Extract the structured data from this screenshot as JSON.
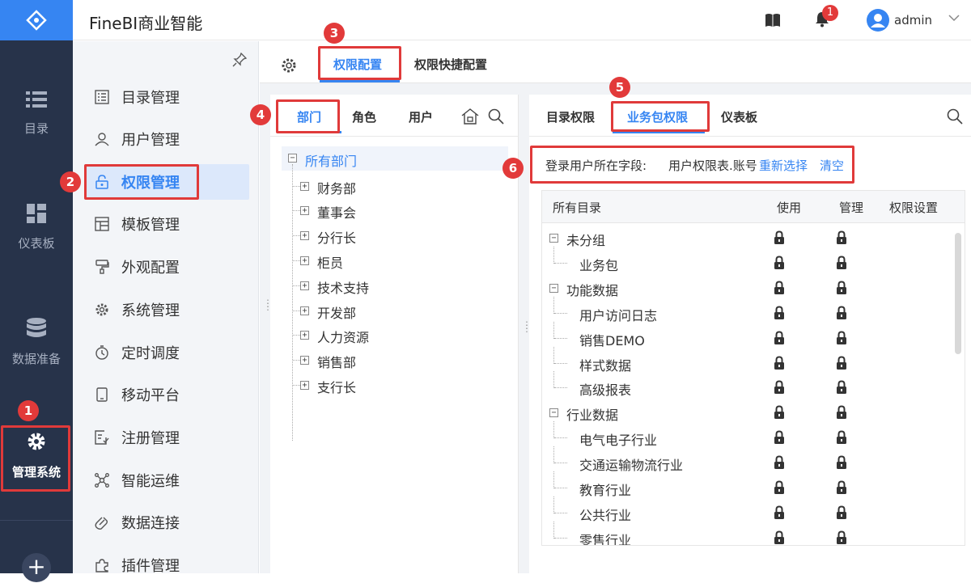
{
  "app": {
    "title": "FineBI商业智能"
  },
  "rail": {
    "items": [
      {
        "label": "目录",
        "icon": "list-icon"
      },
      {
        "label": "仪表板",
        "icon": "dashboard-icon"
      },
      {
        "label": "数据准备",
        "icon": "database-icon"
      },
      {
        "label": "管理系统",
        "icon": "gear-icon"
      }
    ],
    "add_label": "+"
  },
  "topbar": {
    "notification_count": "1",
    "user": "admin"
  },
  "menu": {
    "items": [
      {
        "label": "目录管理",
        "icon": "catalog-icon"
      },
      {
        "label": "用户管理",
        "icon": "user-icon"
      },
      {
        "label": "权限管理",
        "icon": "lock-icon"
      },
      {
        "label": "模板管理",
        "icon": "template-icon"
      },
      {
        "label": "外观配置",
        "icon": "paint-icon"
      },
      {
        "label": "系统管理",
        "icon": "gear-icon"
      },
      {
        "label": "定时调度",
        "icon": "timer-icon"
      },
      {
        "label": "移动平台",
        "icon": "mobile-icon"
      },
      {
        "label": "注册管理",
        "icon": "register-icon"
      },
      {
        "label": "智能运维",
        "icon": "ops-icon"
      },
      {
        "label": "数据连接",
        "icon": "link-icon"
      },
      {
        "label": "插件管理",
        "icon": "plugin-icon"
      }
    ]
  },
  "tabs": {
    "config": "权限配置",
    "quick": "权限快捷配置"
  },
  "left_tabs": {
    "dept": "部门",
    "role": "角色",
    "user": "用户"
  },
  "dept_tree": {
    "root": "所有部门",
    "children": [
      "财务部",
      "董事会",
      "分行长",
      "柜员",
      "技术支持",
      "开发部",
      "人力资源",
      "销售部",
      "支行长"
    ]
  },
  "right_tabs": {
    "catalog": "目录权限",
    "package": "业务包权限",
    "dashboard": "仪表板"
  },
  "field": {
    "label": "登录用户所在字段:",
    "value": "用户权限表.账号",
    "reselect": "重新选择",
    "clear": "清空"
  },
  "grid": {
    "headers": {
      "all": "所有目录",
      "use": "使用",
      "manage": "管理",
      "settings": "权限设置"
    },
    "rows": [
      {
        "label": "未分组",
        "level": 0
      },
      {
        "label": "业务包",
        "level": 1
      },
      {
        "label": "功能数据",
        "level": 0
      },
      {
        "label": "用户访问日志",
        "level": 1
      },
      {
        "label": "销售DEMO",
        "level": 1
      },
      {
        "label": "样式数据",
        "level": 1
      },
      {
        "label": "高级报表",
        "level": 1
      },
      {
        "label": "行业数据",
        "level": 0
      },
      {
        "label": "电气电子行业",
        "level": 1
      },
      {
        "label": "交通运输物流行业",
        "level": 1
      },
      {
        "label": "教育行业",
        "level": 1
      },
      {
        "label": "公共行业",
        "level": 1
      },
      {
        "label": "零售行业",
        "level": 1
      }
    ]
  },
  "callouts": {
    "m1": "1",
    "m2": "2",
    "m3": "3",
    "m4": "4",
    "m5": "5",
    "m6": "6"
  },
  "colors": {
    "accent": "#3685f2",
    "rail": "#27334a",
    "callout": "#e03a3a"
  }
}
